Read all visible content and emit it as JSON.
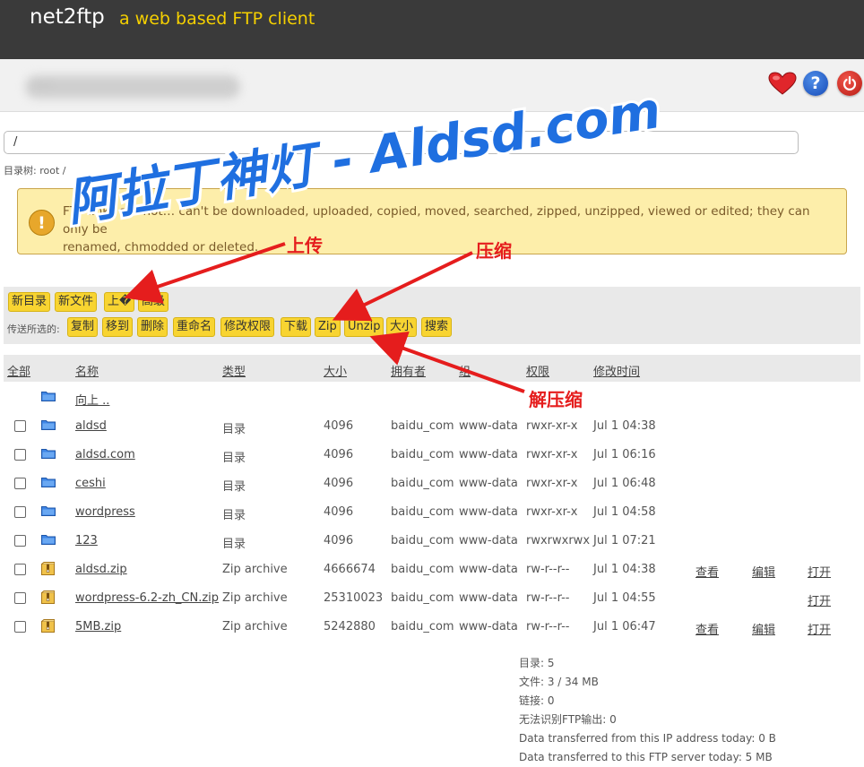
{
  "header": {
    "brand": "net2ftp",
    "tagline": "a web based FTP client"
  },
  "subheader": {
    "host_blurred": "···"
  },
  "path": {
    "value": "/",
    "dirtree": "目录树: root /"
  },
  "warning": {
    "line1": "FTP links are not… can't be downloaded, uploaded, copied, moved, searched, zipped, unzipped, viewed or edited; they can only be",
    "line2": "renamed, chmodded or deleted."
  },
  "toolbar": {
    "row1": [
      "新目录",
      "新文件",
      "上�",
      "高级"
    ],
    "selected_label": "传送所选的:",
    "row2": [
      "复制",
      "移到",
      "删除",
      "重命名",
      "修改权限",
      "下载",
      "Zip",
      "Unzip",
      "大小",
      "搜索"
    ]
  },
  "table": {
    "headers": [
      "全部",
      "名称",
      "类型",
      "大小",
      "拥有者",
      "组",
      "权限",
      "修改时间"
    ],
    "up_label": "向上 ..",
    "rows": [
      {
        "name": "aldsd",
        "type": "目录",
        "size": "4096",
        "owner": "baidu_com",
        "group": "www-data",
        "perms": "rwxr-xr-x",
        "mtime": "Jul 1 04:38",
        "icon": "folder-icon"
      },
      {
        "name": "aldsd.com",
        "type": "目录",
        "size": "4096",
        "owner": "baidu_com",
        "group": "www-data",
        "perms": "rwxr-xr-x",
        "mtime": "Jul 1 06:16",
        "icon": "folder-icon"
      },
      {
        "name": "ceshi",
        "type": "目录",
        "size": "4096",
        "owner": "baidu_com",
        "group": "www-data",
        "perms": "rwxr-xr-x",
        "mtime": "Jul 1 06:48",
        "icon": "folder-icon"
      },
      {
        "name": "wordpress",
        "type": "目录",
        "size": "4096",
        "owner": "baidu_com",
        "group": "www-data",
        "perms": "rwxr-xr-x",
        "mtime": "Jul 1 04:58",
        "icon": "folder-icon"
      },
      {
        "name": "123",
        "type": "目录",
        "size": "4096",
        "owner": "baidu_com",
        "group": "www-data",
        "perms": "rwxrwxrwx",
        "mtime": "Jul 1 07:21",
        "icon": "folder-icon"
      },
      {
        "name": "aldsd.zip",
        "type": "Zip archive",
        "size": "4666674",
        "owner": "baidu_com",
        "group": "www-data",
        "perms": "rw-r--r--",
        "mtime": "Jul 1 04:38",
        "icon": "zip-icon",
        "view": "查看",
        "edit": "编辑",
        "open": "打开"
      },
      {
        "name": "wordpress-6.2-zh_CN.zip",
        "type": "Zip archive",
        "size": "25310023",
        "owner": "baidu_com",
        "group": "www-data",
        "perms": "rw-r--r--",
        "mtime": "Jul 1 04:55",
        "icon": "zip-icon",
        "open": "打开"
      },
      {
        "name": "5MB.zip",
        "type": "Zip archive",
        "size": "5242880",
        "owner": "baidu_com",
        "group": "www-data",
        "perms": "rw-r--r--",
        "mtime": "Jul 1 06:47",
        "icon": "zip-icon",
        "view": "查看",
        "edit": "编辑",
        "open": "打开"
      }
    ]
  },
  "stats": [
    "目录: 5",
    "文件: 3 / 34 MB",
    "链接: 0",
    "无法识别FTP输出: 0",
    "Data transferred from this IP address today: 0 B",
    "Data transferred to this FTP server today: 5 MB"
  ],
  "overlay": {
    "watermark": "阿拉丁神灯 - Aldsd.com",
    "label_upload": "上传",
    "label_zip": "压缩",
    "label_unzip": "解压缩"
  },
  "colors": {
    "header_bg": "#3a3a3a",
    "tagline": "#f5d000",
    "button": "#f8d431",
    "warning_bg": "#fdeeaa",
    "annotation": "#e51d1d",
    "watermark": "#1f6fe0"
  }
}
